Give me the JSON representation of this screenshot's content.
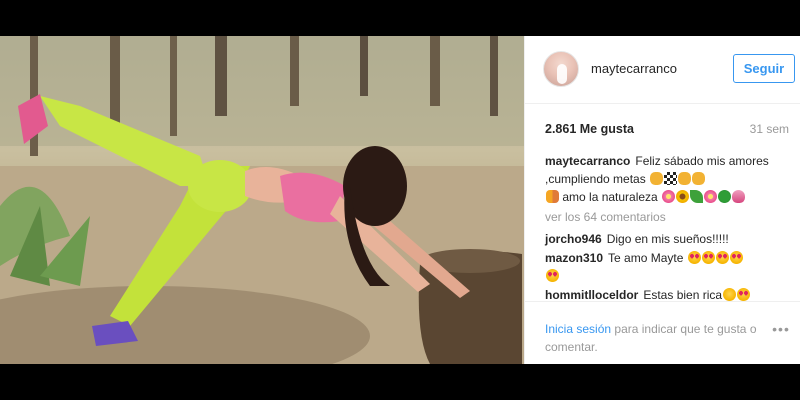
{
  "post": {
    "username": "maytecarranco",
    "follow_label": "Seguir",
    "likes": "2.861 Me gusta",
    "time": "31 sem",
    "caption": {
      "user": "maytecarranco",
      "text": "Feliz sábado mis amores ,cumpliendo metas",
      "text2": "amo la naturaleza"
    },
    "view_all": "ver los 64 comentarios",
    "comments": [
      {
        "user": "jorcho946",
        "text": "Digo en mis sueños!!!!!"
      },
      {
        "user": "mazon310",
        "text": "Te amo Mayte"
      },
      {
        "user": "hommitlloceldor",
        "text": "Estas bien rica"
      }
    ],
    "footer": {
      "login_link": "Inicia sesión",
      "login_rest": "para indicar que te gusta o comentar.",
      "more_icon": "more-options-icon"
    }
  },
  "colors": {
    "accent": "#3897f0",
    "muted": "#999999",
    "text": "#262626",
    "letterbox": "#000000"
  }
}
